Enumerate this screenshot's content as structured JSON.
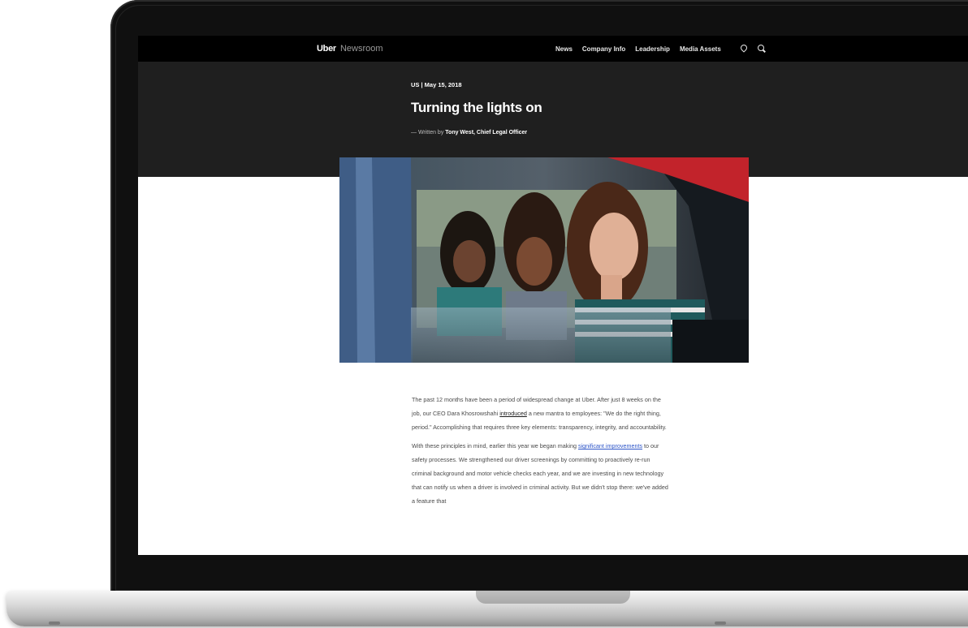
{
  "site": {
    "brand": "Uber",
    "section": "Newsroom"
  },
  "nav": {
    "items": [
      "News",
      "Company Info",
      "Leadership",
      "Media Assets"
    ],
    "icons": [
      "location-pin-icon",
      "search-icon"
    ]
  },
  "article": {
    "dateline": "US | May 15, 2018",
    "title": "Turning the lights on",
    "byline_prefix": "— Written by",
    "author": "Tony West, Chief Legal Officer",
    "p1": {
      "before_link": "The past 12 months have been a period of widespread change at Uber. After just 8 weeks on the job, our CEO Dara Khosrowshahi ",
      "link": "introduced",
      "after_link": " a new mantra to employees: \"We do the right thing, period.\" Accomplishing that requires three key elements: transparency, integrity, and accountability."
    },
    "p2": {
      "before_link": "With these principles in mind, earlier this year we began making ",
      "link": "significant improvements",
      "after_link": " to our safety processes. We strengthened our driver screenings by committing to proactively re-run criminal background and motor vehicle checks each year, and we are investing in new technology that can notify us when a driver is involved in criminal activity. But we didn't stop there: we've added a feature that"
    }
  },
  "colors": {
    "header": "#000000",
    "hero_band": "#1f1f1f",
    "link_blue": "#2d55c8"
  }
}
